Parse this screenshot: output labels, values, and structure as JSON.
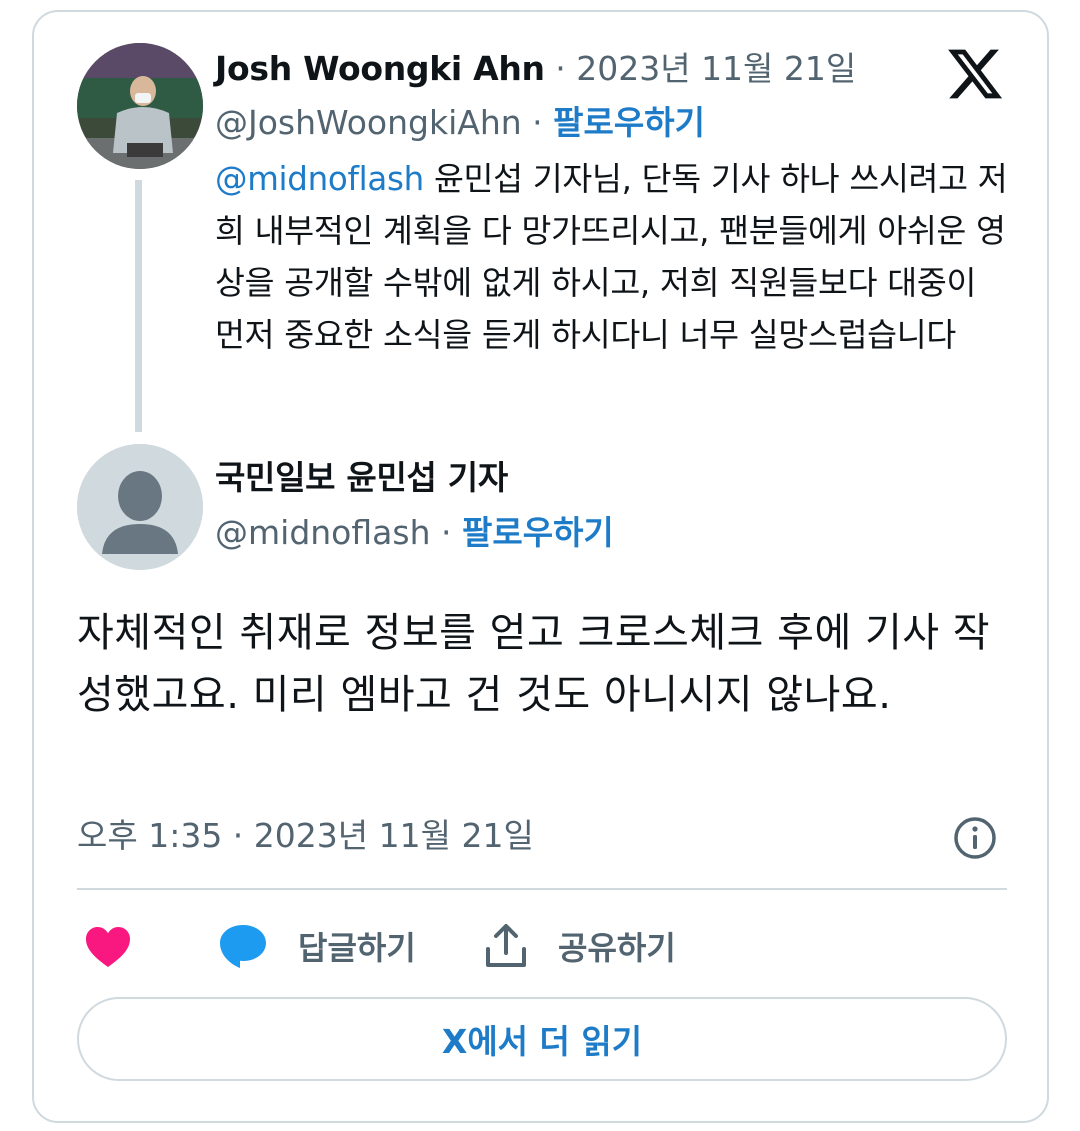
{
  "colors": {
    "accent": "#1d7bc8",
    "muted": "#536471",
    "border": "#cfd9de",
    "like": "#f91880"
  },
  "parent_tweet": {
    "display_name": "Josh Woongki Ahn",
    "separator": "·",
    "date": "2023년 11월 21일",
    "handle": "@JoshWoongkiAhn",
    "follow_label": "팔로우하기",
    "mention": "@midnoflash",
    "text": " 윤민섭 기자님, 단독 기사 하나 쓰시려고 저희 내부적인 계획을 다 망가뜨리시고, 팬분들에게 아쉬운 영상을 공개할 수밖에 없게 하시고, 저희 직원들보다 대중이 먼저 중요한 소식을 듣게 하시다니 너무 실망스럽습니다"
  },
  "main_tweet": {
    "display_name": "국민일보 윤민섭 기자",
    "handle": "@midnoflash",
    "separator": "·",
    "follow_label": "팔로우하기",
    "text": "자체적인 취재로 정보를 얻고 크로스체크 후에 기사 작성했고요. 미리 엠바고 건 것도 아니시지 않나요.",
    "timestamp": "오후 1:35 · 2023년 11월 21일"
  },
  "actions": {
    "like_icon": "heart-icon",
    "reply_label": "답글하기",
    "share_label": "공유하기"
  },
  "read_more_label": "X에서 더 읽기",
  "brand_icon": "x-logo"
}
